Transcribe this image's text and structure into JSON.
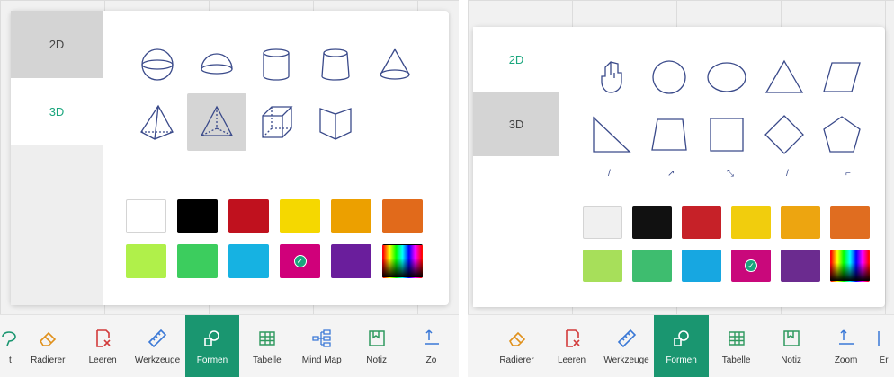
{
  "left": {
    "tabs": [
      {
        "label": "2D",
        "active": false
      },
      {
        "label": "3D",
        "active": true
      }
    ],
    "shapes": [
      "sphere-icon",
      "hemisphere-icon",
      "cylinder-icon",
      "truncated-cylinder-icon",
      "cone-icon",
      "pyramid-icon",
      "tetrahedron-icon",
      "cube-icon",
      "prism-icon"
    ],
    "selected_shape_index": 6,
    "colors": [
      "#ffffff",
      "#000000",
      "#c0111e",
      "#f5d800",
      "#eca000",
      "#e16a1b",
      "#b0f04a",
      "#3ccd5e",
      "#16b2e2",
      "#d0007a",
      "#6a1e9c",
      "spectrum"
    ],
    "selected_color_index": 9,
    "toolbar": [
      {
        "label": "t",
        "icon": "lasso-icon",
        "partial": true
      },
      {
        "label": "Radierer",
        "icon": "eraser-icon"
      },
      {
        "label": "Leeren",
        "icon": "clear-icon"
      },
      {
        "label": "Werkzeuge",
        "icon": "ruler-icon"
      },
      {
        "label": "Formen",
        "icon": "shapes-icon",
        "active": true
      },
      {
        "label": "Tabelle",
        "icon": "table-icon"
      },
      {
        "label": "Mind Map",
        "icon": "mindmap-icon"
      },
      {
        "label": "Notiz",
        "icon": "note-icon"
      },
      {
        "label": "Zo",
        "icon": "zoom-icon",
        "partial": true
      }
    ]
  },
  "right": {
    "tabs": [
      {
        "label": "2D",
        "active": true
      },
      {
        "label": "3D",
        "active": false
      }
    ],
    "shapes": [
      "hand-pointer-icon",
      "circle-icon",
      "ellipse-icon",
      "triangle-icon",
      "parallelogram-icon",
      "right-triangle-icon",
      "trapezoid-icon",
      "square-icon",
      "diamond-icon",
      "pentagon-icon"
    ],
    "colors": [
      "#f0f0f0",
      "#111111",
      "#c62128",
      "#f1cd0d",
      "#eda510",
      "#e06d20",
      "#a7df5a",
      "#3ebd6f",
      "#17a7e1",
      "#c9087b",
      "#6b2b8f",
      "spectrum"
    ],
    "selected_color_index": 9,
    "toolbar": [
      {
        "label": "Radierer",
        "icon": "eraser-icon"
      },
      {
        "label": "Leeren",
        "icon": "clear-icon"
      },
      {
        "label": "Werkzeuge",
        "icon": "ruler-icon"
      },
      {
        "label": "Formen",
        "icon": "shapes-icon",
        "active": true
      },
      {
        "label": "Tabelle",
        "icon": "table-icon"
      },
      {
        "label": "Notiz",
        "icon": "note-icon"
      },
      {
        "label": "Zoom",
        "icon": "zoom-icon"
      },
      {
        "label": "Er",
        "icon": "extra-icon",
        "partial": true
      }
    ]
  }
}
